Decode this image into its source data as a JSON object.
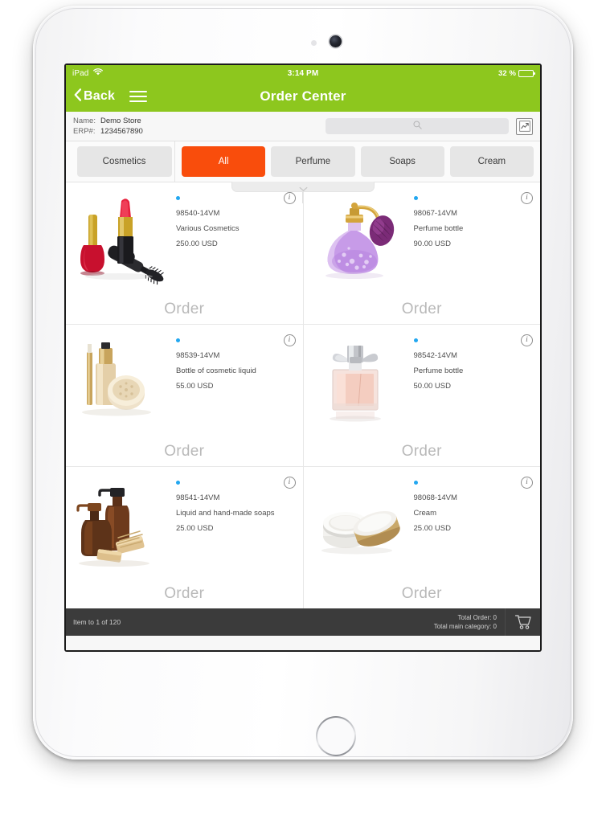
{
  "device": {
    "name": "ipad-tablet"
  },
  "status_bar": {
    "device_label": "iPad",
    "wifi_icon": "wifi-icon",
    "time": "3:14 PM",
    "battery_percent": "32 %",
    "battery_level": 32,
    "battery_icon": "battery-icon"
  },
  "nav_bar": {
    "back_label": "Back",
    "back_icon": "chevron-left-icon",
    "menu_icon": "hamburger-menu-icon",
    "title": "Order Center",
    "background_color": "#8dc71e"
  },
  "info_bar": {
    "name_key": "Name:",
    "name_value": "Demo Store",
    "erp_key": "ERP#:",
    "erp_value": "1234567890",
    "search": {
      "value": "",
      "placeholder": "",
      "icon": "search-icon"
    },
    "chart_button_icon": "chart-image-icon"
  },
  "tabs": {
    "main_category": {
      "label": "Cosmetics",
      "active": false
    },
    "collapse_handle_icon": "chevron-down-icon",
    "items": [
      {
        "label": "All",
        "active": true
      },
      {
        "label": "Perfume",
        "active": false
      },
      {
        "label": "Soaps",
        "active": false
      },
      {
        "label": "Cream",
        "active": false
      }
    ],
    "active_color": "#f94d0c",
    "inactive_color": "#e6e6e6"
  },
  "products": [
    {
      "sku": "98540-14VM",
      "name": "Various Cosmetics",
      "price": "250.00 USD",
      "order_label": "Order",
      "status_dot_color": "#22a7f0",
      "info_icon": "info-icon",
      "image": "cosmetics-lipstick-nailpolish-mascara"
    },
    {
      "sku": "98067-14VM",
      "name": "Perfume bottle",
      "price": "90.00 USD",
      "order_label": "Order",
      "status_dot_color": "#22a7f0",
      "info_icon": "info-icon",
      "image": "purple-atomizer-perfume-bottle"
    },
    {
      "sku": "98539-14VM",
      "name": "Bottle of cosmetic liquid",
      "price": "55.00 USD",
      "order_label": "Order",
      "status_dot_color": "#22a7f0",
      "info_icon": "info-icon",
      "image": "foundation-bottle-powder-jar"
    },
    {
      "sku": "98542-14VM",
      "name": "Perfume bottle",
      "price": "50.00 USD",
      "order_label": "Order",
      "status_dot_color": "#22a7f0",
      "info_icon": "info-icon",
      "image": "pink-square-perfume-bottle"
    },
    {
      "sku": "98541-14VM",
      "name": "Liquid and hand-made soaps",
      "price": "25.00 USD",
      "order_label": "Order",
      "status_dot_color": "#22a7f0",
      "info_icon": "info-icon",
      "image": "brown-soap-dispensers-and-bars"
    },
    {
      "sku": "98068-14VM",
      "name": "Cream",
      "price": "25.00 USD",
      "order_label": "Order",
      "status_dot_color": "#22a7f0",
      "info_icon": "info-icon",
      "image": "white-gold-cream-jar"
    }
  ],
  "footer": {
    "pagination": "Item to 1 of 120",
    "total_order": "Total Order: 0",
    "total_main_category": "Total main category: 0",
    "cart_icon": "shopping-cart-icon",
    "background_color": "#3b3b3b"
  }
}
